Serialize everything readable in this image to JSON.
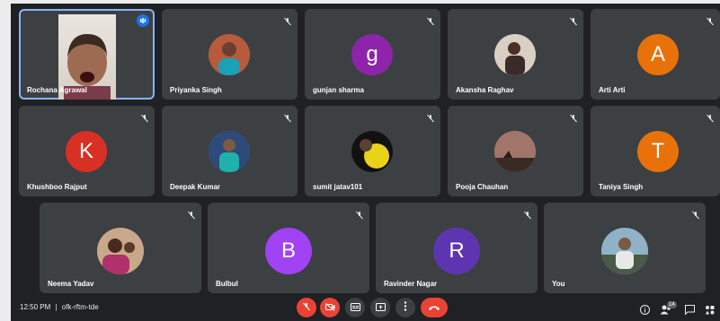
{
  "participants": {
    "rochana": {
      "name": "Rochana Agrawal"
    },
    "priyanka": {
      "name": "Priyanka Singh"
    },
    "gunjan": {
      "name": "gunjan sharma",
      "initial": "g",
      "color": "#8e24aa"
    },
    "akansha": {
      "name": "Akansha Raghav"
    },
    "arti": {
      "name": "Arti Arti",
      "initial": "A",
      "color": "#e8710a"
    },
    "khushboo": {
      "name": "Khushboo Rajput",
      "initial": "K",
      "color": "#d93025"
    },
    "deepak": {
      "name": "Deepak Kumar"
    },
    "sumit": {
      "name": "sumit jatav101"
    },
    "pooja": {
      "name": "Pooja Chauhan"
    },
    "taniya": {
      "name": "Taniya Singh",
      "initial": "T",
      "color": "#e8710a"
    },
    "neema": {
      "name": "Neema Yadav"
    },
    "bulbul": {
      "name": "Bulbul",
      "initial": "B",
      "color": "#a142f4"
    },
    "ravinder": {
      "name": "Ravinder Nagar",
      "initial": "R",
      "color": "#5e35b1"
    },
    "you": {
      "name": "You"
    }
  },
  "bottom_bar": {
    "time": "12:50 PM",
    "meeting_code": "ofk-rftm-tde",
    "separator": "|",
    "participant_count": "14"
  },
  "colors": {
    "background": "#202124",
    "tile": "#3c4043",
    "danger": "#ea4335",
    "accent": "#1a73e8"
  }
}
